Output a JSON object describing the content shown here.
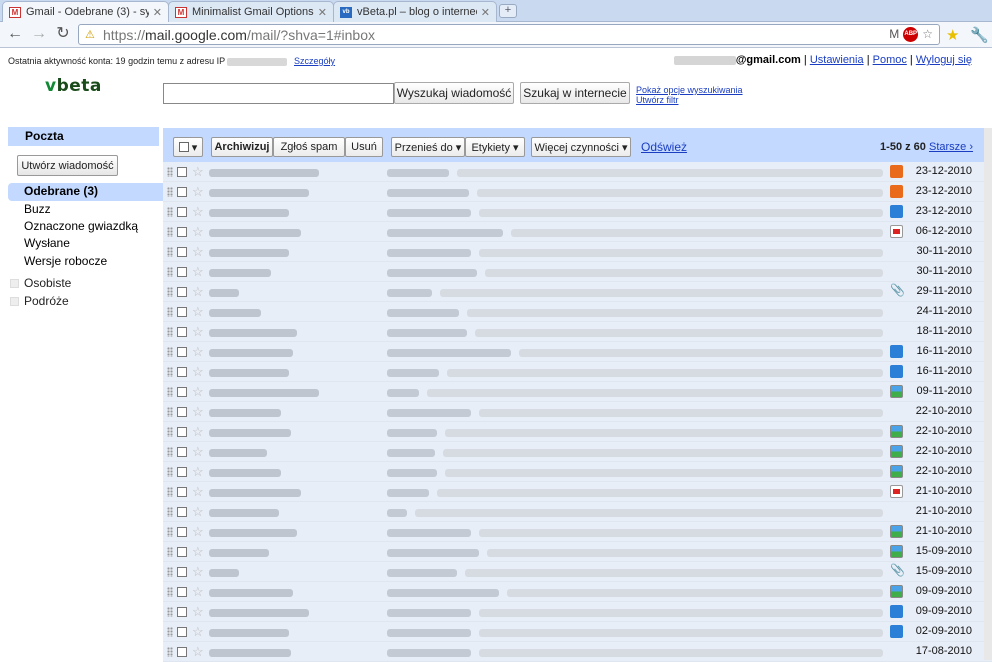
{
  "browser": {
    "tabs": [
      {
        "title": "Gmail - Odebrane (3) - sy...",
        "icon": "gmail-icon",
        "active": true
      },
      {
        "title": "Minimalist Gmail Options",
        "icon": "gmail-icon",
        "active": false
      },
      {
        "title": "vBeta.pl – blog o internec...",
        "icon": "vbeta-icon",
        "active": false
      }
    ],
    "new_tab": "+",
    "url_scheme": "https://",
    "url_host": "mail.google.com",
    "url_path": "/mail/?shva=1#inbox",
    "abp_label": "ABP"
  },
  "header": {
    "last_activity": "Ostatnia aktywność konta: 19 godzin temu z adresu IP",
    "details_link": "Szczegóły",
    "email_suffix": "@gmail.com",
    "settings_link": "Ustawienia",
    "help_link": "Pomoc",
    "logout_link": "Wyloguj się",
    "sep": "|"
  },
  "logo": {
    "v": "v",
    "rest": "beta"
  },
  "search": {
    "value": "",
    "search_mail_button": "Wyszukaj wiadomość",
    "search_web_button": "Szukaj w internecie",
    "show_options_link": "Pokaż opcje wyszukiwania",
    "create_filter_link": "Utwórz filtr"
  },
  "nav": {
    "mail_label": "Poczta",
    "compose_button": "Utwórz wiadomość",
    "items": [
      {
        "label": "Odebrane (3)",
        "selected": true
      },
      {
        "label": "Buzz",
        "selected": false
      },
      {
        "label": "Oznaczone gwiazdką",
        "selected": false
      },
      {
        "label": "Wysłane",
        "selected": false
      },
      {
        "label": "Wersje robocze",
        "selected": false
      }
    ],
    "labels": [
      "Osobiste",
      "Podróże"
    ]
  },
  "actions": {
    "archive": "Archiwizuj",
    "spam": "Zgłoś spam",
    "delete": "Usuń",
    "move_to": "Przenieś do ▾",
    "labels": "Etykiety ▾",
    "more": "Więcej czynności ▾",
    "refresh": "Odśwież",
    "select_arrow": "▾",
    "page_count": "1-50 z 60",
    "older": "Starsze ›"
  },
  "messages": [
    {
      "date": "23-12-2010",
      "attachment": "office",
      "unread": false
    },
    {
      "date": "23-12-2010",
      "attachment": "office",
      "unread": false
    },
    {
      "date": "23-12-2010",
      "attachment": "doc",
      "unread": false
    },
    {
      "date": "06-12-2010",
      "attachment": "pdf",
      "unread": false
    },
    {
      "date": "30-11-2010",
      "attachment": "",
      "unread": false
    },
    {
      "date": "30-11-2010",
      "attachment": "",
      "unread": false
    },
    {
      "date": "29-11-2010",
      "attachment": "clip",
      "unread": false
    },
    {
      "date": "24-11-2010",
      "attachment": "",
      "unread": false
    },
    {
      "date": "18-11-2010",
      "attachment": "",
      "unread": false
    },
    {
      "date": "16-11-2010",
      "attachment": "doc",
      "unread": false
    },
    {
      "date": "16-11-2010",
      "attachment": "doc",
      "unread": false
    },
    {
      "date": "09-11-2010",
      "attachment": "img",
      "unread": false
    },
    {
      "date": "22-10-2010",
      "attachment": "",
      "unread": false
    },
    {
      "date": "22-10-2010",
      "attachment": "img",
      "unread": false
    },
    {
      "date": "22-10-2010",
      "attachment": "img",
      "unread": false
    },
    {
      "date": "22-10-2010",
      "attachment": "img",
      "unread": false
    },
    {
      "date": "21-10-2010",
      "attachment": "pdf",
      "unread": false
    },
    {
      "date": "21-10-2010",
      "attachment": "",
      "unread": false
    },
    {
      "date": "21-10-2010",
      "attachment": "img",
      "unread": false
    },
    {
      "date": "15-09-2010",
      "attachment": "img",
      "unread": false
    },
    {
      "date": "15-09-2010",
      "attachment": "clip",
      "unread": false
    },
    {
      "date": "09-09-2010",
      "attachment": "img",
      "unread": false
    },
    {
      "date": "09-09-2010",
      "attachment": "doc",
      "unread": false
    },
    {
      "date": "02-09-2010",
      "attachment": "doc",
      "unread": false
    },
    {
      "date": "17-08-2010",
      "attachment": "",
      "unread": false
    }
  ],
  "colors": {
    "accent": "#c3d9ff",
    "link": "#1a3dc1"
  }
}
